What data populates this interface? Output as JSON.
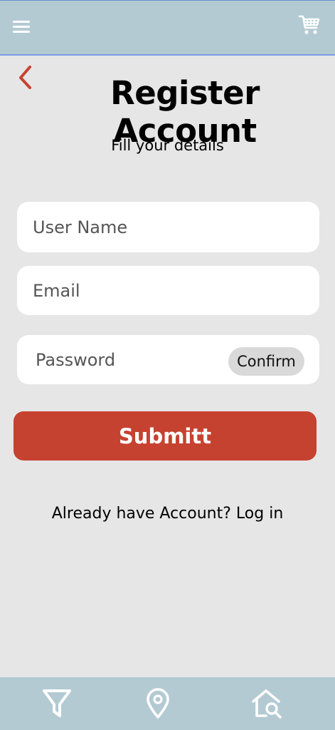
{
  "header": {
    "menu_icon": "hamburger-menu-icon",
    "cart_icon": "cart-icon"
  },
  "back_icon": "chevron-left-icon",
  "title": "Register Account",
  "subtitle": "Fill your details",
  "form": {
    "username_placeholder": "User Name",
    "email_placeholder": "Email",
    "password_placeholder": "Password",
    "confirm_label": "Confirm",
    "submit_label": "Submitt"
  },
  "login_prompt": {
    "text": "Already have Account? ",
    "link": "Log in"
  },
  "bottom_nav": {
    "items": [
      {
        "icon": "filter-icon"
      },
      {
        "icon": "location-pin-icon"
      },
      {
        "icon": "home-search-icon"
      }
    ]
  },
  "colors": {
    "bar_background": "#b3cad3",
    "page_background": "#e6e6e6",
    "accent_red": "#c64230"
  }
}
